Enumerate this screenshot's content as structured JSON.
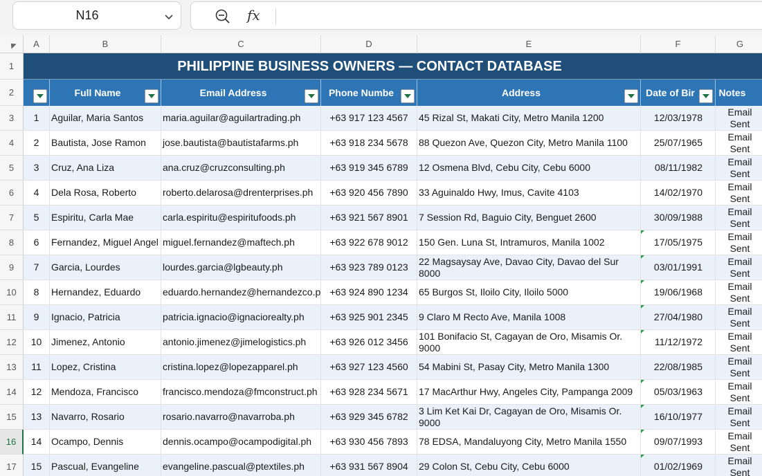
{
  "formula_bar": {
    "name_box": "N16",
    "formula": "",
    "icons": {
      "zoom": "zoom-out-icon",
      "fx": "fx"
    }
  },
  "columns": [
    "A",
    "B",
    "C",
    "D",
    "E",
    "F",
    "G"
  ],
  "row_numbers": [
    "1",
    "2",
    "3",
    "4",
    "5",
    "6",
    "7",
    "8",
    "9",
    "10",
    "11",
    "12",
    "13",
    "14",
    "15",
    "16",
    "17"
  ],
  "selected_row": "16",
  "title": "PHILIPPINE BUSINESS OWNERS — CONTACT DATABASE",
  "headers": [
    "#",
    "Full Name",
    "Email Address",
    "Phone Numbe",
    "Address",
    "Date of Bir",
    "Notes"
  ],
  "colors": {
    "title_bg": "#1f4e79",
    "header_bg": "#2e75b6",
    "band": "#eaf1fa",
    "selection": "#1e7145"
  },
  "records": [
    {
      "num": "1",
      "name": "Aguilar, Maria Santos",
      "email": "maria.aguilar@aguilartrading.ph",
      "phone": "+63 917 123 4567",
      "address": "45 Rizal St, Makati City, Metro Manila 1200",
      "dob": "12/03/1978",
      "notes": "Email Sent"
    },
    {
      "num": "2",
      "name": "Bautista, Jose Ramon",
      "email": "jose.bautista@bautistafarms.ph",
      "phone": "+63 918 234 5678",
      "address": "88 Quezon Ave, Quezon City, Metro Manila 1100",
      "dob": "25/07/1965",
      "notes": "Email Sent"
    },
    {
      "num": "3",
      "name": "Cruz, Ana Liza",
      "email": "ana.cruz@cruzconsulting.ph",
      "phone": "+63 919 345 6789",
      "address": "12 Osmena Blvd, Cebu City, Cebu 6000",
      "dob": "08/11/1982",
      "notes": "Email Sent"
    },
    {
      "num": "4",
      "name": "Dela Rosa, Roberto",
      "email": "roberto.delarosa@drenterprises.ph",
      "phone": "+63 920 456 7890",
      "address": "33 Aguinaldo Hwy, Imus, Cavite 4103",
      "dob": "14/02/1970",
      "notes": "Email Sent"
    },
    {
      "num": "5",
      "name": "Espiritu, Carla Mae",
      "email": "carla.espiritu@espiritufoods.ph",
      "phone": "+63 921 567 8901",
      "address": "7 Session Rd, Baguio City, Benguet 2600",
      "dob": "30/09/1988",
      "notes": "Email Sent"
    },
    {
      "num": "6",
      "name": "Fernandez, Miguel Angel",
      "email": "miguel.fernandez@maftech.ph",
      "phone": "+63 922 678 9012",
      "address": "150 Gen. Luna St, Intramuros, Manila 1002",
      "dob": "17/05/1975",
      "notes": "Email Sent"
    },
    {
      "num": "7",
      "name": "Garcia, Lourdes",
      "email": "lourdes.garcia@lgbeauty.ph",
      "phone": "+63 923 789 0123",
      "address": "22 Magsaysay Ave, Davao City, Davao del Sur 8000",
      "dob": "03/01/1991",
      "notes": "Email Sent"
    },
    {
      "num": "8",
      "name": "Hernandez, Eduardo",
      "email": "eduardo.hernandez@hernandezco.ph",
      "phone": "+63 924 890 1234",
      "address": "65 Burgos St, Iloilo City, Iloilo 5000",
      "dob": "19/06/1968",
      "notes": "Email Sent"
    },
    {
      "num": "9",
      "name": "Ignacio, Patricia",
      "email": "patricia.ignacio@ignaciorealty.ph",
      "phone": "+63 925 901 2345",
      "address": "9 Claro M Recto Ave, Manila 1008",
      "dob": "27/04/1980",
      "notes": "Email Sent"
    },
    {
      "num": "10",
      "name": "Jimenez, Antonio",
      "email": "antonio.jimenez@jimelogistics.ph",
      "phone": "+63 926 012 3456",
      "address": "101 Bonifacio St, Cagayan de Oro, Misamis Or. 9000",
      "dob": "11/12/1972",
      "notes": "Email Sent"
    },
    {
      "num": "11",
      "name": "Lopez, Cristina",
      "email": "cristina.lopez@lopezapparel.ph",
      "phone": "+63 927 123 4560",
      "address": "54 Mabini St, Pasay City, Metro Manila 1300",
      "dob": "22/08/1985",
      "notes": "Email Sent"
    },
    {
      "num": "12",
      "name": "Mendoza, Francisco",
      "email": "francisco.mendoza@fmconstruct.ph",
      "phone": "+63 928 234 5671",
      "address": "17 MacArthur Hwy, Angeles City, Pampanga 2009",
      "dob": "05/03/1963",
      "notes": "Email Sent"
    },
    {
      "num": "13",
      "name": "Navarro, Rosario",
      "email": "rosario.navarro@navarroba.ph",
      "phone": "+63 929 345 6782",
      "address": "3 Lim Ket Kai Dr, Cagayan de Oro, Misamis Or. 9000",
      "dob": "16/10/1977",
      "notes": "Email Sent"
    },
    {
      "num": "14",
      "name": "Ocampo, Dennis",
      "email": "dennis.ocampo@ocampodigital.ph",
      "phone": "+63 930 456 7893",
      "address": "78 EDSA, Mandaluyong City, Metro Manila 1550",
      "dob": "09/07/1993",
      "notes": "Email Sent"
    },
    {
      "num": "15",
      "name": "Pascual, Evangeline",
      "email": "evangeline.pascual@ptextiles.ph",
      "phone": "+63 931 567 8904",
      "address": "29 Colon St, Cebu City, Cebu 6000",
      "dob": "01/02/1969",
      "notes": "Email Sent"
    }
  ]
}
